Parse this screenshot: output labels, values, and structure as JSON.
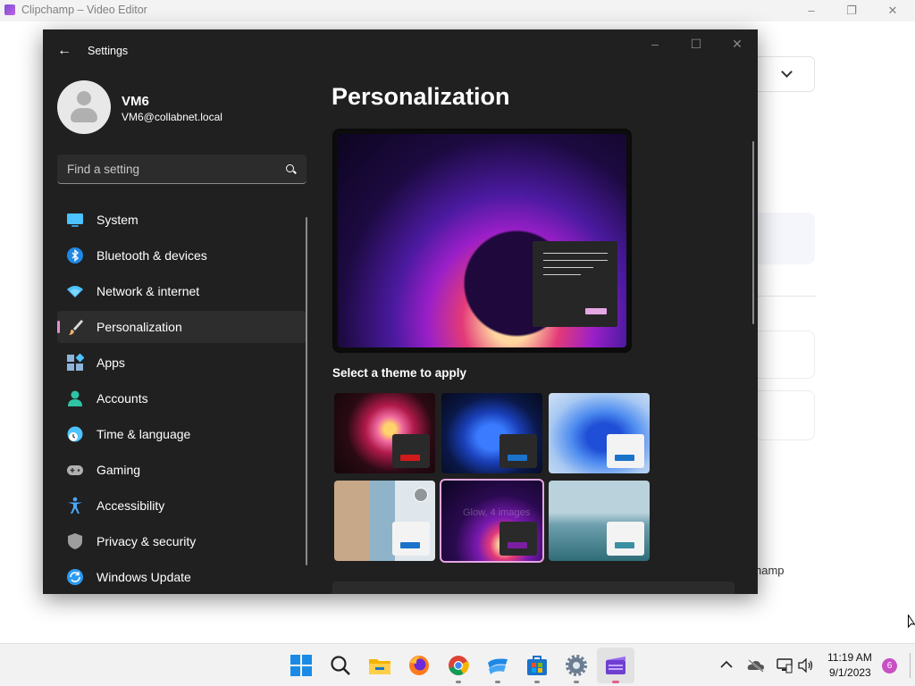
{
  "background_window": {
    "title": "Clipchamp – Video Editor",
    "partial_text": "hamp",
    "controls": {
      "minimize": "–",
      "restore": "❐",
      "close": "✕"
    }
  },
  "settings": {
    "window_title": "Settings",
    "back_glyph": "←",
    "controls": {
      "minimize": "–",
      "maximize": "☐",
      "close": "✕"
    },
    "user": {
      "name": "VM6",
      "email": "VM6@collabnet.local"
    },
    "search": {
      "placeholder": "Find a setting"
    },
    "nav": [
      {
        "label": "System",
        "icon": "monitor-icon",
        "color": "#4cc2ff"
      },
      {
        "label": "Bluetooth & devices",
        "icon": "bluetooth-icon",
        "color": "#1e88e5"
      },
      {
        "label": "Network & internet",
        "icon": "wifi-icon",
        "color": "#4cc2ff"
      },
      {
        "label": "Personalization",
        "icon": "brush-icon",
        "color": "#f2b36b",
        "active": true
      },
      {
        "label": "Apps",
        "icon": "apps-icon",
        "color": "#8fb4d9"
      },
      {
        "label": "Accounts",
        "icon": "person-icon",
        "color": "#2ec4a5"
      },
      {
        "label": "Time & language",
        "icon": "globe-clock-icon",
        "color": "#4cc2ff"
      },
      {
        "label": "Gaming",
        "icon": "gamepad-icon",
        "color": "#b0b0b0"
      },
      {
        "label": "Accessibility",
        "icon": "accessibility-icon",
        "color": "#4aa8ff"
      },
      {
        "label": "Privacy & security",
        "icon": "shield-icon",
        "color": "#9e9e9e"
      },
      {
        "label": "Windows Update",
        "icon": "refresh-icon",
        "color": "#2b9af3"
      }
    ],
    "page_title": "Personalization",
    "select_theme_label": "Select a theme to apply",
    "themes": [
      {
        "name": "theme-flower",
        "bar_color": "#d11a1a"
      },
      {
        "name": "theme-bloom-dark",
        "bar_color": "#1a73c9"
      },
      {
        "name": "theme-bloom-light",
        "bar_color": "#1a73c9"
      },
      {
        "name": "theme-captured-motion",
        "bar_color": "#1a73c9"
      },
      {
        "name": "theme-glow",
        "bar_color": "#7b1fa2",
        "overlay": "Glow, 4 images",
        "selected": true
      },
      {
        "name": "theme-flow",
        "bar_color": "#3a8fa0"
      }
    ]
  },
  "taskbar": {
    "time": "11:19 AM",
    "date": "9/1/2023",
    "notification_count": "6",
    "apps": [
      "start-icon",
      "search-icon",
      "file-explorer-icon",
      "firefox-icon",
      "chrome-icon",
      "teams-icon",
      "store-icon",
      "settings-icon",
      "clipchamp-icon"
    ]
  }
}
